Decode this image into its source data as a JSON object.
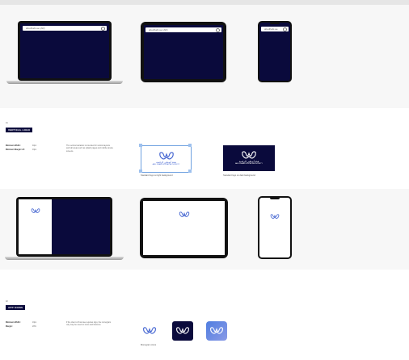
{
  "top_band": {
    "laptop_search_placeholder": "abudhabi.ae (AR)",
    "tablet_search_placeholder": "abudhabi.ae (AR)",
    "phone_search_placeholder": "abudhabi.ae"
  },
  "section_vertical": {
    "number": "01",
    "tag_label": "VERTICAL LOGO",
    "spec_rows": [
      {
        "label": "Minimum Width:",
        "value": "40px"
      },
      {
        "label": "Minimum Margin LR:",
        "value": "16px"
      }
    ],
    "description": "The vertical variation is intended for narrow layouts and tall areas such as splash pages and mobile device screens.",
    "logo_on_light_caption": "Standard logo on light background",
    "logo_on_dark_caption": "Standard logo on dark background",
    "logo_arabic": "هيئة أبوظبي الرقمية",
    "logo_english": "ABU DHABI DIGITAL AUTHORITY"
  },
  "section_appicons": {
    "number": "02",
    "tag_label": "APP ICONS",
    "spec_rows": [
      {
        "label": "Minimum Width:",
        "value": "16px"
      },
      {
        "label": "Margin:",
        "value": "20%"
      }
    ],
    "description": "If the client or final use requires logo, the monogram only may be used on icons and favicons.",
    "icon_caption": "Monogram icons"
  },
  "colors": {
    "navy": "#0a0a3c",
    "brand_blue": "#4a6fd8",
    "gradient_start": "#4f7de0",
    "gradient_end": "#8a9ae6"
  }
}
